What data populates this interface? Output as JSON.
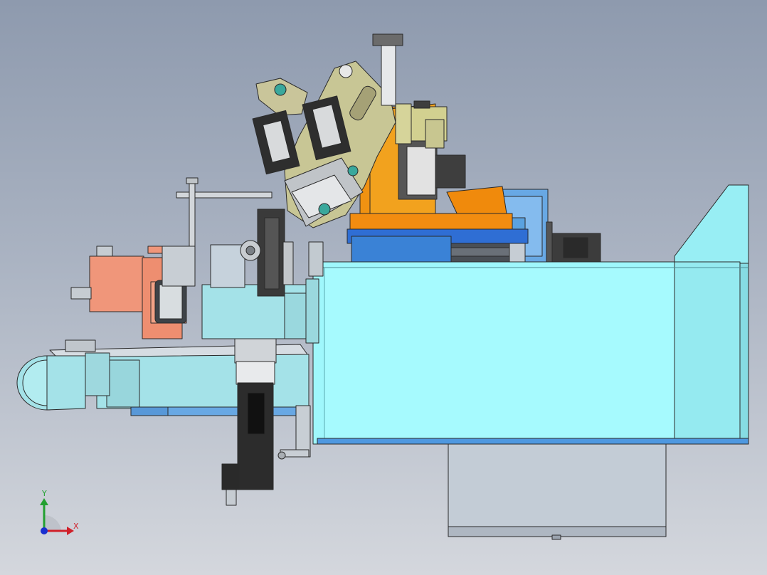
{
  "viewport": {
    "background_top": "#8e9aae",
    "background_bottom": "#d4d7dd"
  },
  "triad": {
    "x_label": "X",
    "y_label": "Y",
    "x_color": "#d0202a",
    "y_color": "#22a030",
    "z_color": "#1a2fd0"
  },
  "colors": {
    "cyan_body": "#9ff7fc",
    "light_teal": "#a4e2e8",
    "blue_plate": "#68a8e4",
    "orange": "#f09212",
    "olive": "#c8c695",
    "salmon": "#f0967a",
    "dark_gray": "#3c3c3c",
    "steel": "#c6cdd4"
  }
}
